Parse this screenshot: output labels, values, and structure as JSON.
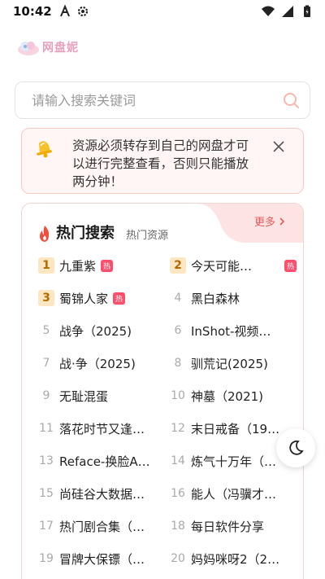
{
  "status_bar": {
    "time": "10:42",
    "icons": [
      "a-icon",
      "gear-icon",
      "wifi-icon",
      "signal-icon",
      "battery-icon"
    ]
  },
  "logo": {
    "text": "网盘妮"
  },
  "search": {
    "placeholder": "请输入搜索关键词"
  },
  "notice": {
    "text": "资源必须转存到自己的网盘才可以进行完整查看，否则只能播放两分钟！"
  },
  "hot": {
    "title": "热门搜索",
    "subtitle": "热门资源",
    "more_label": "更多",
    "badge_label": "热",
    "items": [
      {
        "rank": "1",
        "name": "九重紫",
        "hot": true
      },
      {
        "rank": "2",
        "name": "今天可能…",
        "hot": true
      },
      {
        "rank": "3",
        "name": "蜀锦人家",
        "hot": true
      },
      {
        "rank": "4",
        "name": "黑白森林",
        "hot": false
      },
      {
        "rank": "5",
        "name": "战争（2025)",
        "hot": false
      },
      {
        "rank": "6",
        "name": "InShot-视频…",
        "hot": false
      },
      {
        "rank": "7",
        "name": "战·争（2025)",
        "hot": false
      },
      {
        "rank": "8",
        "name": "驯荒记(2025)",
        "hot": false
      },
      {
        "rank": "9",
        "name": "无耻混蛋",
        "hot": false
      },
      {
        "rank": "10",
        "name": "神墓（2021)",
        "hot": false
      },
      {
        "rank": "11",
        "name": "落花时节又逢…",
        "hot": false
      },
      {
        "rank": "12",
        "name": "末日戒备（19…",
        "hot": false
      },
      {
        "rank": "13",
        "name": "Reface-换脸A…",
        "hot": false
      },
      {
        "rank": "14",
        "name": "炼气十万年（…",
        "hot": false
      },
      {
        "rank": "15",
        "name": "尚硅谷大数据…",
        "hot": false
      },
      {
        "rank": "16",
        "name": "能人（冯骥才…",
        "hot": false
      },
      {
        "rank": "17",
        "name": "热门剧合集（…",
        "hot": false
      },
      {
        "rank": "18",
        "name": "每日软件分享",
        "hot": false
      },
      {
        "rank": "19",
        "name": "冒牌大保镖（…",
        "hot": false
      },
      {
        "rank": "20",
        "name": "妈妈咪呀2（2…",
        "hot": false
      }
    ]
  },
  "colors": {
    "accent": "#e55a5a",
    "notice_bg": "#fff6f5",
    "notice_border": "#f7c9c5",
    "rank_top_bg": "#fde7c2",
    "badge_bg": "#ff4d6a"
  }
}
